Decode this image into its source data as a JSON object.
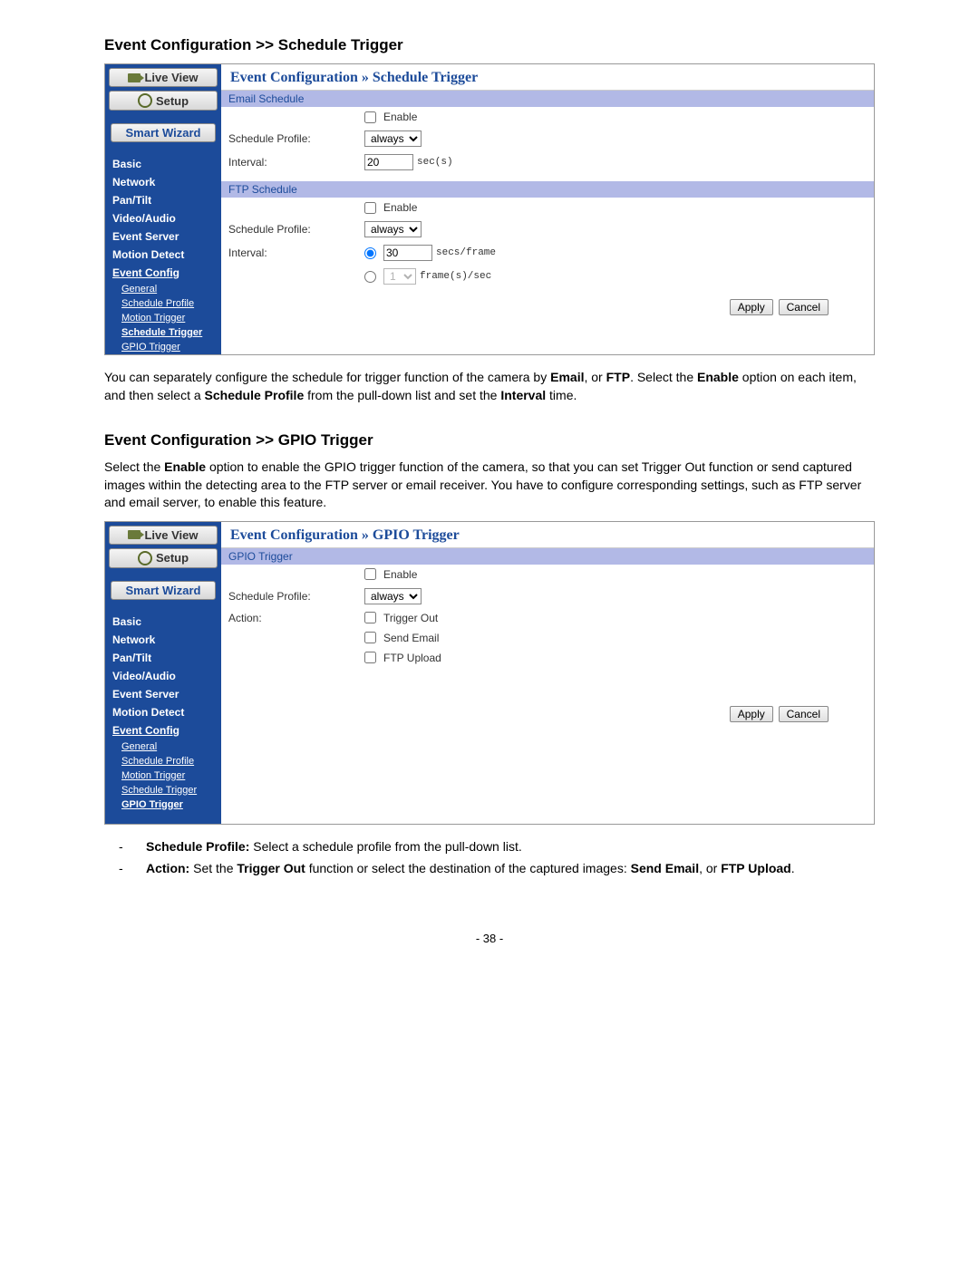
{
  "page_number": "- 38 -",
  "section1": {
    "title": "Event Configuration >> Schedule Trigger",
    "breadcrumb": "Event Configuration » Schedule Trigger",
    "body_html": "You can separately configure the schedule for trigger function of the camera by <b>Email</b>, or <b>FTP</b>. Select the <b>Enable</b> option on each item, and then select a <b>Schedule Profile</b> from the pull-down list and set the <b>Interval</b> time."
  },
  "section2": {
    "title": "Event Configuration >> GPIO Trigger",
    "breadcrumb": "Event Configuration » GPIO Trigger",
    "intro": "Select the <b>Enable</b> option to enable the GPIO trigger function of the camera, so that you can set Trigger Out function or send captured images within the detecting area to the FTP server or email receiver. You have to configure corresponding settings, such as FTP server and email server, to enable this feature."
  },
  "sidebar": {
    "live_view": "Live View",
    "setup": "Setup",
    "smart_wizard": "Smart Wizard",
    "links": [
      "Basic",
      "Network",
      "Pan/Tilt",
      "Video/Audio",
      "Event Server",
      "Motion Detect",
      "Event Config"
    ],
    "subs": [
      "General",
      "Schedule Profile",
      "Motion Trigger",
      "Schedule Trigger",
      "GPIO Trigger"
    ]
  },
  "form": {
    "email_header": "Email Schedule",
    "ftp_header": "FTP Schedule",
    "gpio_header": "GPIO Trigger",
    "enable": "Enable",
    "schedule_profile": "Schedule Profile:",
    "interval": "Interval:",
    "action": "Action:",
    "always": "always",
    "interval_val": "20",
    "interval_val2": "30",
    "fps_val": "1",
    "secs": "sec(s)",
    "secs_frame": "secs/frame",
    "frames_sec": "frame(s)/sec",
    "trigger_out": "Trigger Out",
    "send_email": "Send Email",
    "ftp_upload": "FTP Upload",
    "apply": "Apply",
    "cancel": "Cancel"
  },
  "bullets": {
    "b1": "<b>Schedule Profile:</b> Select a schedule profile from the pull-down list.",
    "b2": "<b>Action:</b> Set the <b>Trigger Out</b> function or select the destination of the captured images: <b>Send Email</b>, or <b>FTP Upload</b>."
  }
}
